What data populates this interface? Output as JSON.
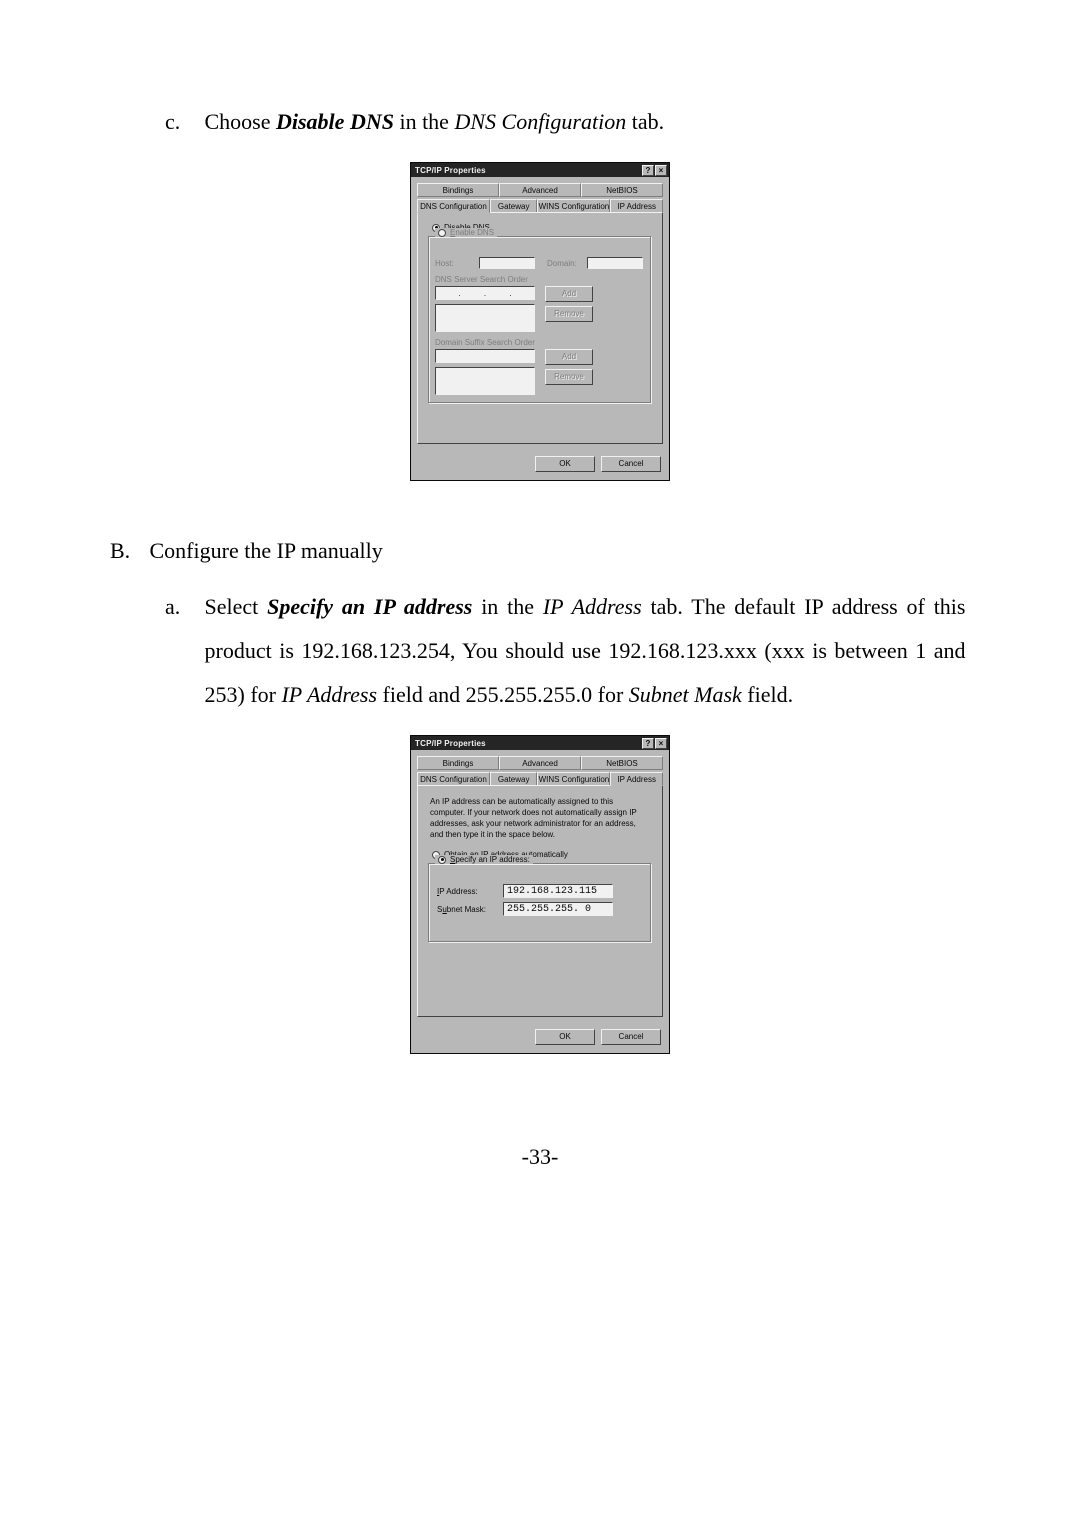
{
  "step_c": {
    "label": "c.",
    "pre": "Choose ",
    "bold": "Disable DNS",
    "mid": " in the ",
    "ital": "DNS Configuration",
    "post": " tab."
  },
  "step_B": {
    "label": "B.",
    "text": "Configure the IP manually"
  },
  "step_a": {
    "label": "a.",
    "t1": "Select ",
    "b1": "Specify an IP address",
    "t2": " in the ",
    "i1": "IP Address",
    "t3": " tab. The default IP address of this product is 192.168.123.254,  You should use 192.168.123.xxx (xxx is between 1 and 253) for ",
    "i2": "IP Address",
    "t4": " field and 255.255.255.0 for ",
    "i3": "Subnet Mask",
    "t5": " field."
  },
  "pagenum": "-33-",
  "dlg1": {
    "title": "TCP/IP Properties",
    "help": "?",
    "close": "×",
    "tabs_top": [
      "Bindings",
      "Advanced",
      "NetBIOS"
    ],
    "tabs_bot": [
      "DNS Configuration",
      "Gateway",
      "WINS Configuration",
      "IP Address"
    ],
    "radio_disable": "Disable DNS",
    "radio_enable": "Enable DNS",
    "host_lbl": "Host:",
    "domain_lbl": "Domain:",
    "sect_dns": "DNS Server Search Order",
    "sect_suffix": "Domain Suffix Search Order",
    "add": "Add",
    "remove": "Remove",
    "ok": "OK",
    "cancel": "Cancel"
  },
  "dlg2": {
    "title": "TCP/IP Properties",
    "help": "?",
    "close": "×",
    "tabs_top": [
      "Bindings",
      "Advanced",
      "NetBIOS"
    ],
    "tabs_bot": [
      "DNS Configuration",
      "Gateway",
      "WINS Configuration",
      "IP Address"
    ],
    "info": "An IP address can be automatically assigned to this computer. If your network does not automatically assign IP addresses, ask your network administrator for an address, and then type it in the space below.",
    "radio_auto": "Obtain an IP address automatically",
    "radio_specify": "Specify an IP address:",
    "ip_lbl": "IP Address:",
    "ip_val": "192.168.123.115",
    "sm_lbl": "Subnet Mask:",
    "sm_val": "255.255.255. 0",
    "ok": "OK",
    "cancel": "Cancel"
  }
}
